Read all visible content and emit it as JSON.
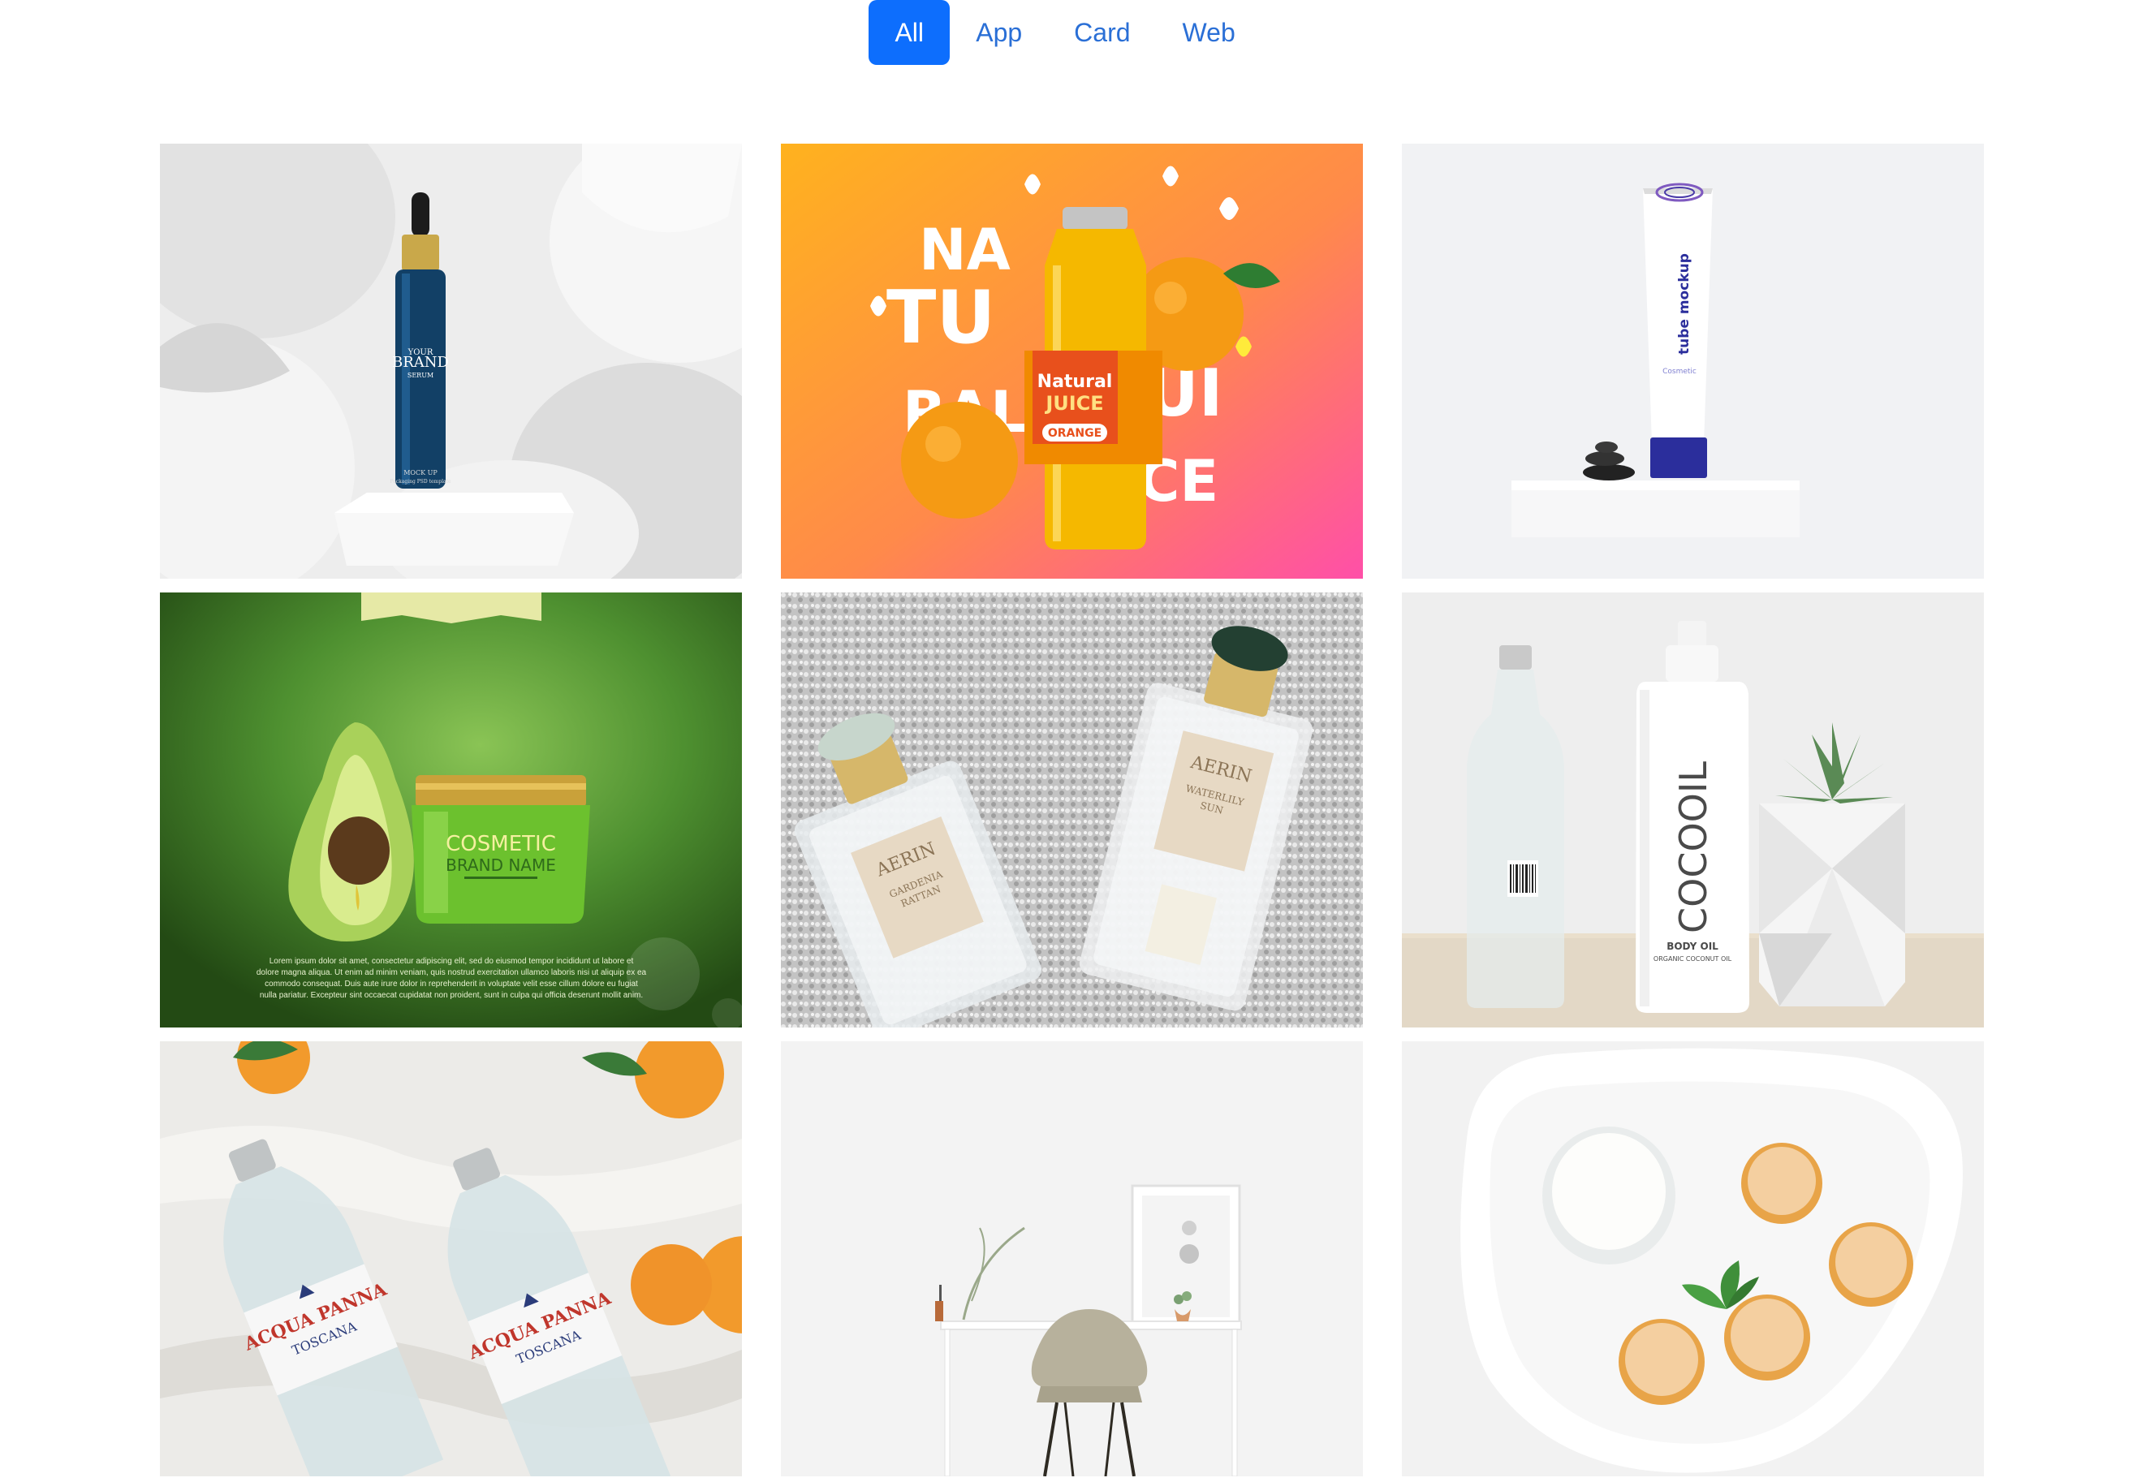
{
  "filters": {
    "all": "All",
    "app": "App",
    "card": "Card",
    "web": "Web"
  },
  "colors": {
    "accent": "#0d6efd",
    "link": "#2a6fd6"
  },
  "portfolio": {
    "item1": {
      "brand_top": "YOUR",
      "brand": "BRAND",
      "serum": "SERUM",
      "mockup": "MOCK UP",
      "mockup_sub": "Packaging PSD template"
    },
    "item2": {
      "na": "NA",
      "tu": "TU",
      "ral": "RAL",
      "jui": "JUI",
      "ce": "CE",
      "label1": "Natural",
      "label2": "JUICE",
      "flavor": "ORANGE"
    },
    "item3": {
      "tube_title": "tube mockup",
      "tube_sub": "Cosmetic"
    },
    "item4": {
      "title": "COSMETIC",
      "subtitle": "BRAND NAME",
      "lorem1": "Lorem ipsum dolor sit amet, consectetur adipiscing elit, sed do eiusmod tempor incididunt ut labore et",
      "lorem2": "dolore magna aliqua. Ut enim ad minim veniam, quis nostrud exercitation ullamco laboris nisi ut aliquip ex ea",
      "lorem3": "commodo consequat. Duis aute irure dolor in reprehenderit in voluptate velit esse cillum dolore eu fugiat",
      "lorem4": "nulla pariatur. Excepteur sint occaecat cupidatat non proident, sunt in culpa qui officia deserunt mollit anim."
    },
    "item5": {
      "brand": "AERIN",
      "left_name1": "GARDENIA",
      "left_name2": "RATTAN",
      "right_name1": "WATERLILY",
      "right_name2": "SUN"
    },
    "item6": {
      "brand": "COCOOIL",
      "product": "BODY OIL",
      "product_sub": "ORGANIC COCONUT OIL"
    },
    "item7": {
      "brand": "ACQUA PANNA",
      "origin": "TOSCANA"
    },
    "item8": {},
    "item9": {}
  }
}
